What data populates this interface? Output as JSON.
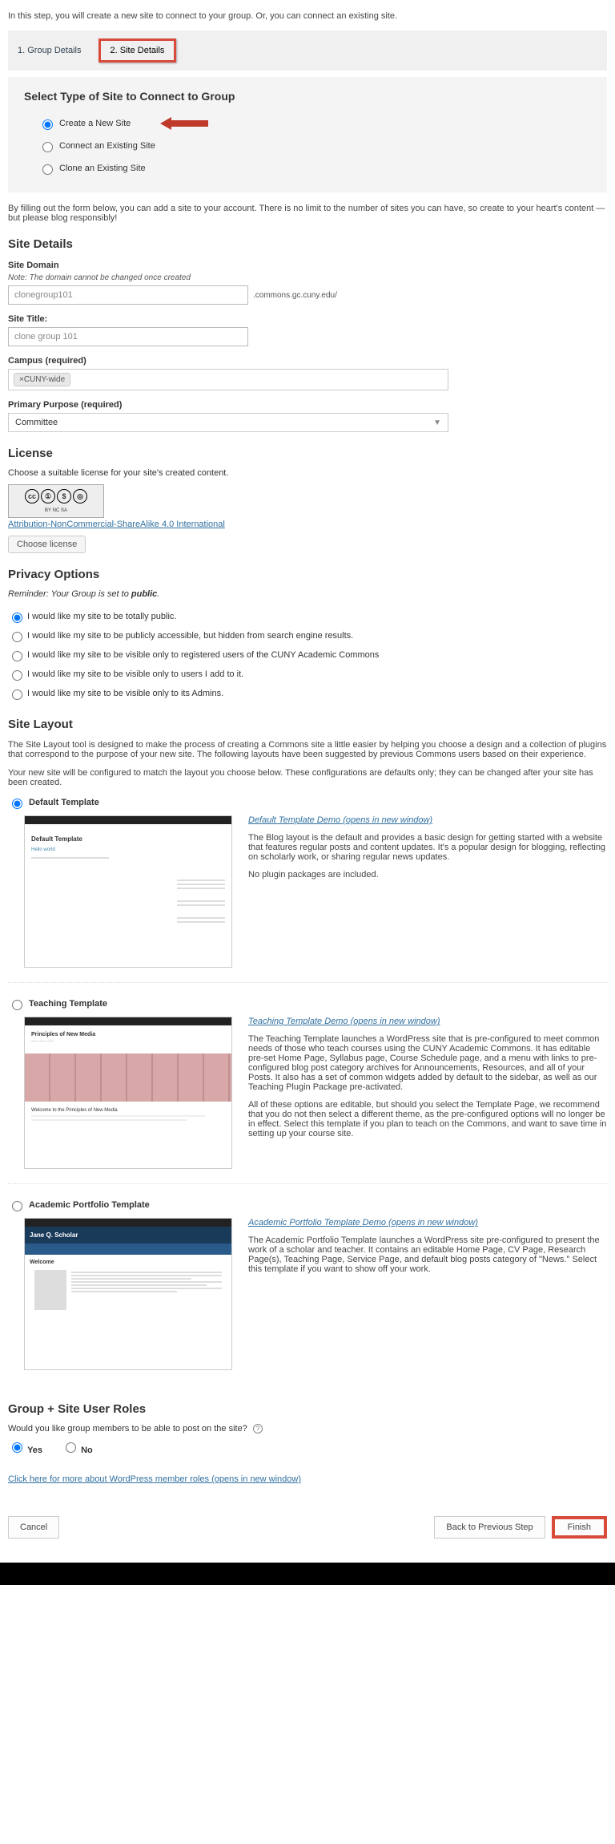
{
  "intro": "In this step, you will create a new site to connect to your group. Or, you can connect an existing site.",
  "tabs": {
    "group_details": "1. Group Details",
    "site_details": "2. Site Details"
  },
  "select_type": {
    "heading": "Select Type of Site to Connect to Group",
    "create_new": "Create a New Site",
    "connect_existing": "Connect an Existing Site",
    "clone_existing": "Clone an Existing Site"
  },
  "form_intro": "By filling out the form below, you can add a site to your account. There is no limit to the number of sites you can have, so create to your heart's content — but please blog responsibly!",
  "site_details": {
    "heading": "Site Details",
    "domain_label": "Site Domain",
    "domain_note": "Note: The domain cannot be changed once created",
    "domain_value": "clonegroup101",
    "domain_suffix": ".commons.gc.cuny.edu/",
    "title_label": "Site Title:",
    "title_value": "clone group 101",
    "campus_label": "Campus (required)",
    "campus_tag": "×CUNY-wide",
    "purpose_label": "Primary Purpose (required)",
    "purpose_value": "Committee"
  },
  "license": {
    "heading": "License",
    "sub": "Choose a suitable license for your site's created content.",
    "link": "Attribution-NonCommercial-ShareAlike 4.0 International",
    "button": "Choose license"
  },
  "privacy": {
    "heading": "Privacy Options",
    "reminder_prefix": "Reminder: Your Group is set to ",
    "reminder_value": "public",
    "reminder_suffix": ".",
    "opt1": "I would like my site to be totally public.",
    "opt2": "I would like my site to be publicly accessible, but hidden from search engine results.",
    "opt3": "I would like my site to be visible only to registered users of the CUNY Academic Commons",
    "opt4": "I would like my site to be visible only to users I add to it.",
    "opt5": "I would like my site to be visible only to its Admins."
  },
  "layout": {
    "heading": "Site Layout",
    "p1": "The Site Layout tool is designed to make the process of creating a Commons site a little easier by helping you choose a design and a collection of plugins that correspond to the purpose of your new site. The following layouts have been suggested by previous Commons users based on their experience.",
    "p2": "Your new site will be configured to match the layout you choose below. These configurations are defaults only; they can be changed after your site has been created.",
    "default": {
      "label": "Default Template",
      "demo": "Default Template Demo (opens in new window)",
      "desc1": "The Blog layout is the default and provides a basic design for getting started with a website that features regular posts and content updates. It's a popular design for blogging, reflecting on scholarly work, or sharing regular news updates.",
      "desc2": "No plugin packages are included."
    },
    "teaching": {
      "label": "Teaching Template",
      "demo": "Teaching Template Demo (opens in new window)",
      "desc1": "The Teaching Template launches a WordPress site that is pre-configured to meet common needs of those who teach courses using the CUNY Academic Commons. It has editable pre-set Home Page, Syllabus page, Course Schedule page, and a menu with links to pre-configured blog post category archives for Announcements, Resources, and all of your Posts. It also has a set of common widgets added by default to the sidebar, as well as our Teaching Plugin Package pre-activated.",
      "desc2": "All of these options are editable, but should you select the Template Page, we recommend that you do not then select a different theme, as the pre-configured options will no longer be in effect. Select this template if you plan to teach on the Commons, and want to save time in setting up your course site."
    },
    "portfolio": {
      "label": "Academic Portfolio Template",
      "demo": "Academic Portfolio Template Demo (opens in new window)",
      "desc1": "The Academic Portfolio Template launches a WordPress site pre-configured to present the work of a scholar and teacher. It contains an editable Home Page, CV Page, Research Page(s), Teaching Page, Service Page, and default blog posts category of \"News.\" Select this template if you want to show off your work.",
      "thumb_name": "Jane Q. Scholar",
      "thumb_welcome": "Welcome"
    }
  },
  "roles": {
    "heading": "Group + Site User Roles",
    "question": "Would you like group members to be able to post on the site?",
    "yes": "Yes",
    "no": "No",
    "link": "Click here for more about WordPress member roles (opens in new window)"
  },
  "footer": {
    "cancel": "Cancel",
    "back": "Back to Previous Step",
    "finish": "Finish"
  }
}
